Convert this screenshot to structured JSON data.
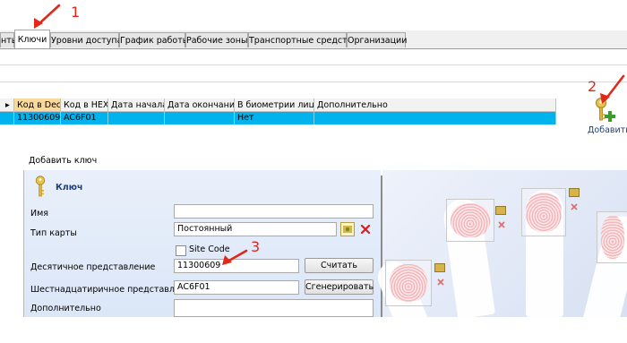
{
  "annotations": {
    "n1": "1",
    "n2": "2",
    "n3": "3"
  },
  "tabs": [
    "нты",
    "Ключи",
    "Уровни доступа",
    "График работы",
    "Рабочие зоны",
    "Транспортные средства",
    "Организации"
  ],
  "grid": {
    "columns": [
      "Код в Dec",
      "Код в HEX",
      "Дата начала",
      "Дата окончания",
      "В биометрии лица",
      "Дополнительно"
    ],
    "row": [
      "11300609",
      "AC6F01",
      "",
      "",
      "Нет",
      ""
    ]
  },
  "add_button": {
    "label": "Добавить"
  },
  "dialog": {
    "title": "Добавить ключ",
    "section": "Ключ",
    "fields": {
      "name": {
        "label": "Имя",
        "value": ""
      },
      "card_type": {
        "label": "Тип карты",
        "value": "Постоянный"
      },
      "site_code": {
        "label": "Site Code",
        "checked": false
      },
      "dec": {
        "label": "Десятичное представление",
        "value": "11300609",
        "button": "Считать"
      },
      "hex": {
        "label": "Шестнадцатиричное представление",
        "value": "AC6F01",
        "button": "Сгенерировать"
      },
      "extra": {
        "label": "Дополнительно",
        "value": ""
      }
    }
  },
  "colors": {
    "selection": "#00b3ec",
    "sorted_header": "#f9d99b",
    "arrow": "#e0281b",
    "delete": "#d42020"
  }
}
